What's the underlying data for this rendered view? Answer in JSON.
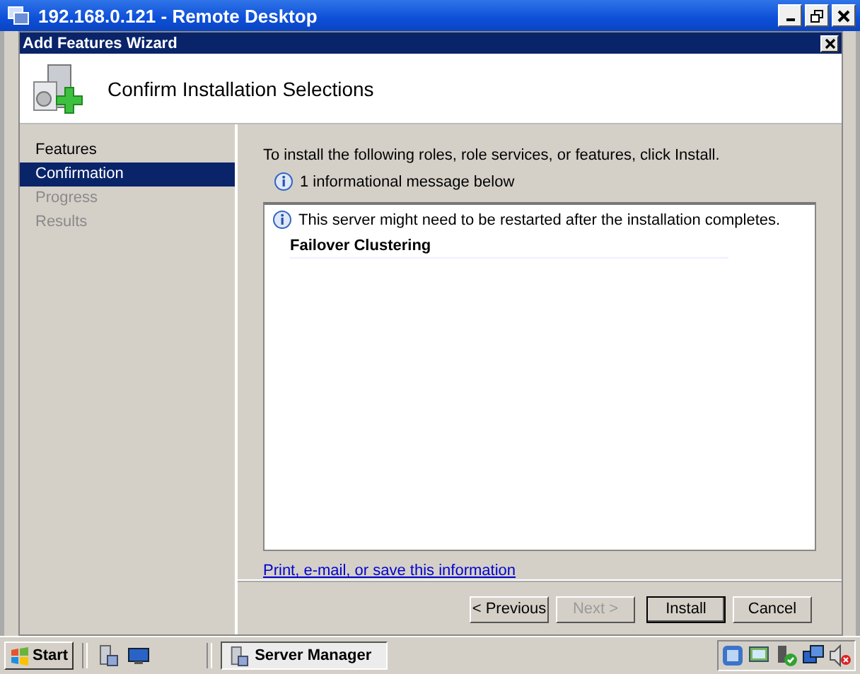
{
  "window": {
    "title": "192.168.0.121 - Remote Desktop"
  },
  "wizard": {
    "title": "Add Features Wizard",
    "heading": "Confirm Installation Selections"
  },
  "steps": [
    {
      "label": "Features",
      "selected": false,
      "disabled": false
    },
    {
      "label": "Confirmation",
      "selected": true,
      "disabled": false
    },
    {
      "label": "Progress",
      "selected": false,
      "disabled": true
    },
    {
      "label": "Results",
      "selected": false,
      "disabled": true
    }
  ],
  "content": {
    "intro": "To install the following roles, role services, or features, click Install.",
    "info": "1 informational message below",
    "message": "This server might need to be restarted after the installation completes.",
    "feature": "Failover Clustering",
    "link": "Print, e-mail, or save this information"
  },
  "buttons": [
    {
      "label": "< Previous",
      "disabled": false,
      "default": false
    },
    {
      "label": "Next >",
      "disabled": true,
      "default": false
    },
    {
      "label": "Install",
      "disabled": false,
      "default": true
    },
    {
      "label": "Cancel",
      "disabled": false,
      "default": false
    }
  ],
  "taskbar": {
    "start": "Start",
    "tasks": [
      {
        "label": "Server Manager"
      }
    ]
  }
}
